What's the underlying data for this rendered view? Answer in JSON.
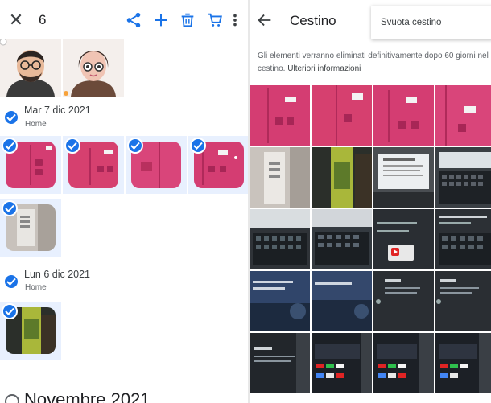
{
  "selection_bar": {
    "close_icon": "close-icon",
    "count": "6",
    "actions": [
      "share-icon",
      "add-icon",
      "trash-icon",
      "cart-icon",
      "more-vert-icon"
    ]
  },
  "groups": [
    {
      "date": "Mar 7 dic 2021",
      "location": "Home"
    },
    {
      "date": "Lun 6 dic 2021",
      "location": "Home"
    }
  ],
  "month_header": "Novembre 2021",
  "trash": {
    "title": "Cestino",
    "menu_item": "Svuota cestino",
    "notice": "Gli elementi verranno eliminati definitivamente dopo 60 giorni nel cestino.",
    "more_info_link": "Ulteriori informazioni"
  },
  "colors": {
    "accent": "#1a73e8",
    "selected_bg": "#e8f0fe",
    "pink": "#d6386f"
  }
}
